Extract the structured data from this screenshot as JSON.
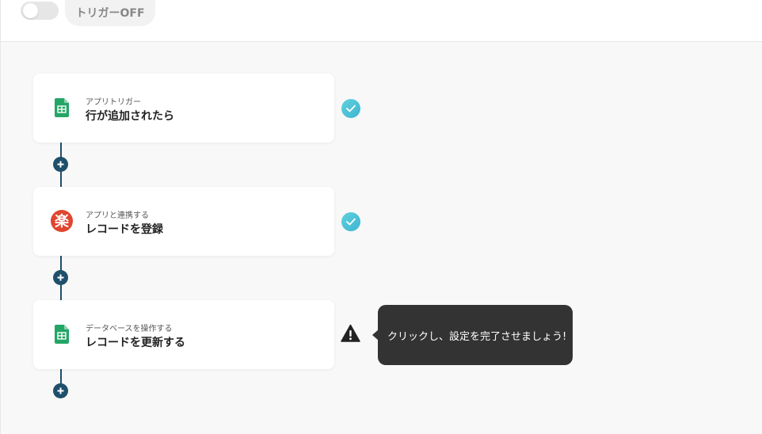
{
  "trigger": {
    "toggle_state": "off",
    "label": "トリガーOFF"
  },
  "flow": {
    "steps": [
      {
        "app_icon": "google-sheets-icon",
        "subtitle": "アプリトリガー",
        "title": "行が追加されたら",
        "status": "check-icon"
      },
      {
        "app_icon": "rakuten-icon",
        "app_icon_glyph": "楽",
        "subtitle": "アプリと連携する",
        "title": "レコードを登録",
        "status": "check-icon"
      },
      {
        "app_icon": "google-sheets-icon",
        "subtitle": "データベースを操作する",
        "title": "レコードを更新する",
        "status": "warning-icon"
      }
    ],
    "add_step_icon": "plus-icon"
  },
  "tooltip": {
    "text": "クリックし、設定を完了させましょう!"
  },
  "colors": {
    "flow_line": "#1e4f6b",
    "check": "#4cc3d9",
    "sheets_green": "#23a566",
    "rakuten_red": "#e0452f",
    "tooltip_bg": "#333333"
  }
}
